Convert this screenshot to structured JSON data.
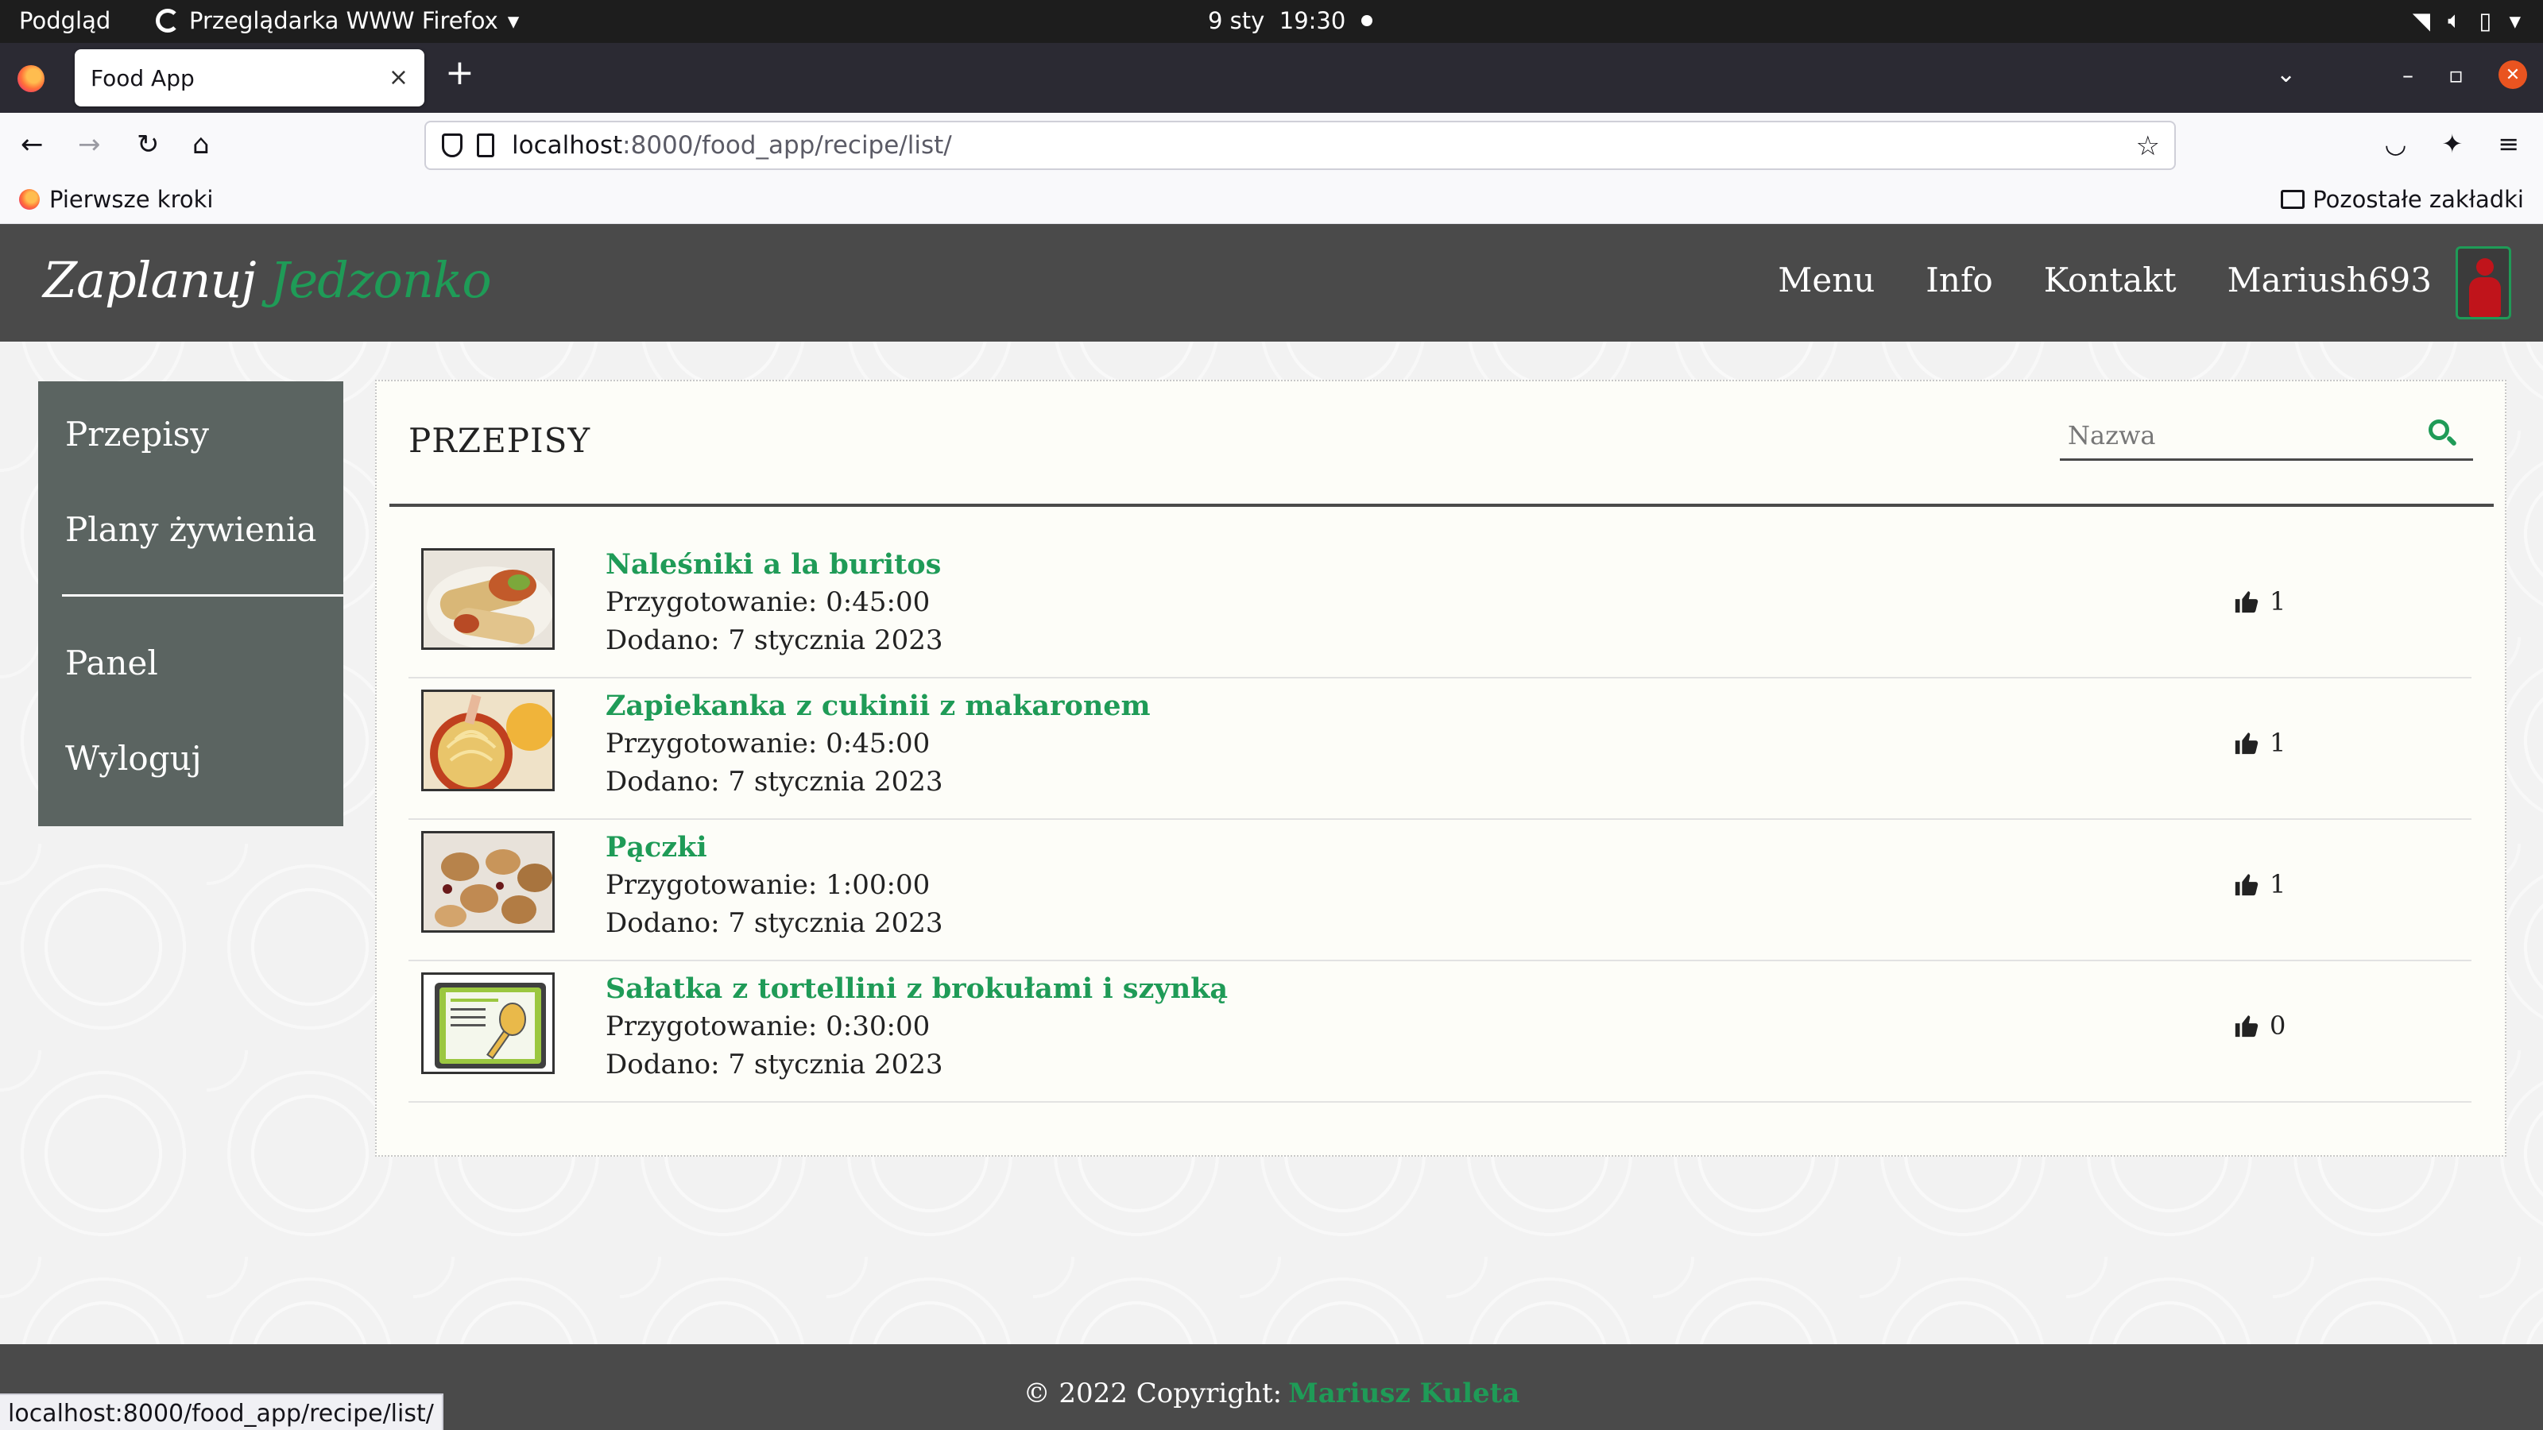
{
  "os": {
    "activities": "Podgląd",
    "app_name": "Przeglądarka WWW Firefox",
    "date": "9 sty",
    "time": "19:30"
  },
  "browser": {
    "tab_title": "Food App",
    "url_host": "localhost",
    "url_path": ":8000/food_app/recipe/list/",
    "bookmark_left": "Pierwsze kroki",
    "bookmark_right": "Pozostałe zakładki",
    "status_url": "localhost:8000/food_app/recipe/list/"
  },
  "site": {
    "brand_main": "Zaplanuj",
    "brand_accent": "Jedzonko",
    "nav": [
      "Menu",
      "Info",
      "Kontakt",
      "Mariush693"
    ],
    "accent_color": "#1f9b57"
  },
  "sidebar": {
    "items": [
      "Przepisy",
      "Plany żywienia",
      "Panel",
      "Wyloguj"
    ]
  },
  "main": {
    "title": "PRZEPISY",
    "search_placeholder": "Nazwa",
    "recipes": [
      {
        "name": "Naleśniki a la buritos",
        "prep": "Przygotowanie: 0:45:00",
        "date": "Dodano: 7 stycznia 2023",
        "likes": "1",
        "thumb": "burrito-photo"
      },
      {
        "name": "Zapiekanka z cukinii z makaronem",
        "prep": "Przygotowanie: 0:45:00",
        "date": "Dodano: 7 stycznia 2023",
        "likes": "1",
        "thumb": "pasta-photo"
      },
      {
        "name": "Pączki",
        "prep": "Przygotowanie: 1:00:00",
        "date": "Dodano: 7 stycznia 2023",
        "likes": "1",
        "thumb": "donuts-photo"
      },
      {
        "name": "Sałatka z tortellini z brokułami i szynką",
        "prep": "Przygotowanie: 0:30:00",
        "date": "Dodano: 7 stycznia 2023",
        "likes": "0",
        "thumb": "recipe-card-placeholder"
      }
    ]
  },
  "footer": {
    "copyright": "© 2022 Copyright:",
    "author": "Mariusz Kuleta"
  }
}
